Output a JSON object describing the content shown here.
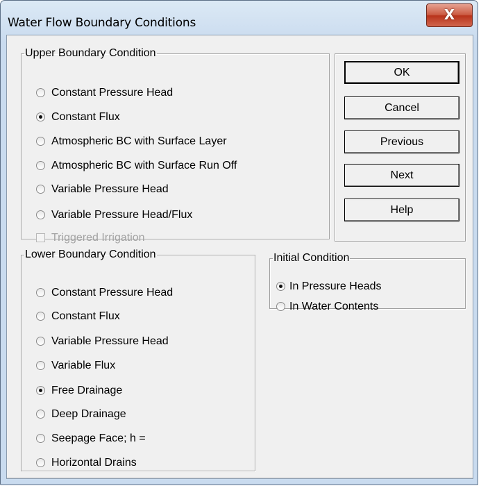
{
  "window": {
    "title": "Water Flow Boundary Conditions",
    "close_glyph": "X"
  },
  "upper": {
    "legend": "Upper Boundary Condition",
    "options": [
      {
        "label": "Constant Pressure Head",
        "selected": false
      },
      {
        "label": "Constant Flux",
        "selected": true
      },
      {
        "label": "Atmospheric BC with Surface Layer",
        "selected": false
      },
      {
        "label": "Atmospheric BC with Surface Run Off",
        "selected": false
      },
      {
        "label": "Variable Pressure Head",
        "selected": false
      },
      {
        "label": "Variable Pressure Head/Flux",
        "selected": false
      }
    ],
    "triggered_irrigation": {
      "label": "Triggered Irrigation",
      "checked": false,
      "enabled": false
    }
  },
  "buttons": {
    "ok": "OK",
    "cancel": "Cancel",
    "previous": "Previous",
    "next": "Next",
    "help": "Help"
  },
  "lower": {
    "legend": "Lower Boundary Condition",
    "options": [
      {
        "label": "Constant Pressure Head",
        "selected": false
      },
      {
        "label": "Constant Flux",
        "selected": false
      },
      {
        "label": "Variable Pressure Head",
        "selected": false
      },
      {
        "label": "Variable Flux",
        "selected": false
      },
      {
        "label": "Free Drainage",
        "selected": true
      },
      {
        "label": "Deep Drainage",
        "selected": false
      },
      {
        "label": "Seepage Face; h =",
        "selected": false
      },
      {
        "label": "Horizontal Drains",
        "selected": false
      }
    ]
  },
  "initial": {
    "legend": "Initial Condition",
    "options": [
      {
        "label": "In Pressure Heads",
        "selected": true
      },
      {
        "label": "In Water Contents",
        "selected": false
      }
    ]
  }
}
